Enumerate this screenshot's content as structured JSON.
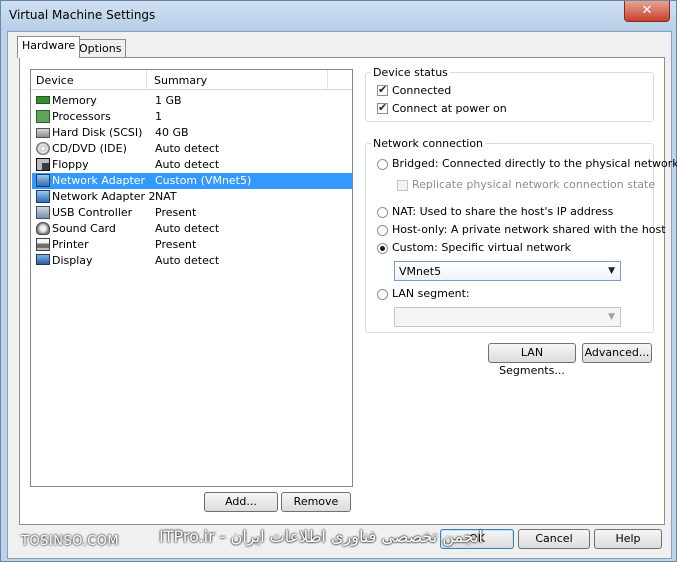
{
  "window": {
    "title": "Virtual Machine Settings",
    "close_glyph": "✕"
  },
  "tabs": [
    {
      "label": "Hardware"
    },
    {
      "label": "Options"
    }
  ],
  "device_list": {
    "headers": {
      "device": "Device",
      "summary": "Summary"
    },
    "rows": [
      {
        "icon": "memory-icon",
        "name": "Memory",
        "summary": "1 GB"
      },
      {
        "icon": "processor-icon",
        "name": "Processors",
        "summary": "1"
      },
      {
        "icon": "hard-disk-icon",
        "name": "Hard Disk (SCSI)",
        "summary": "40 GB"
      },
      {
        "icon": "cd-dvd-icon",
        "name": "CD/DVD (IDE)",
        "summary": "Auto detect"
      },
      {
        "icon": "floppy-icon",
        "name": "Floppy",
        "summary": "Auto detect"
      },
      {
        "icon": "network-adapter-icon",
        "name": "Network Adapter",
        "summary": "Custom (VMnet5)"
      },
      {
        "icon": "network-adapter-icon",
        "name": "Network Adapter 2",
        "summary": "NAT"
      },
      {
        "icon": "usb-icon",
        "name": "USB Controller",
        "summary": "Present"
      },
      {
        "icon": "sound-card-icon",
        "name": "Sound Card",
        "summary": "Auto detect"
      },
      {
        "icon": "printer-icon",
        "name": "Printer",
        "summary": "Present"
      },
      {
        "icon": "display-icon",
        "name": "Display",
        "summary": "Auto detect"
      }
    ],
    "selected": "Network Adapter"
  },
  "list_buttons": {
    "add": "Add...",
    "remove": "Remove"
  },
  "device_status": {
    "title": "Device status",
    "connected": {
      "label": "Connected",
      "checked": true
    },
    "connect_at_power_on": {
      "label": "Connect at power on",
      "checked": true
    }
  },
  "network_connection": {
    "title": "Network connection",
    "bridged": {
      "label": "Bridged: Connected directly to the physical network",
      "selected": false
    },
    "replicate": {
      "label": "Replicate physical network connection state",
      "checked": false,
      "disabled": true
    },
    "nat": {
      "label": "NAT: Used to share the host's IP address",
      "selected": false
    },
    "host_only": {
      "label": "Host-only: A private network shared with the host",
      "selected": false
    },
    "custom": {
      "label": "Custom: Specific virtual network",
      "selected": true
    },
    "custom_select": {
      "value": "VMnet5"
    },
    "lan_segment": {
      "label": "LAN segment:",
      "selected": false
    },
    "lan_select": {
      "value": ""
    }
  },
  "network_buttons": {
    "lan_segments": "LAN Segments...",
    "advanced": "Advanced..."
  },
  "footer_buttons": {
    "ok": "OK",
    "cancel": "Cancel",
    "help": "Help"
  },
  "watermark": {
    "left": "TOSINSO.COM",
    "right": "ITPro.ir - انجمن تخصصی فناوری اطلاعات ایران"
  },
  "colors": {
    "selection": "#3399ff",
    "frame": "#bcd3ea",
    "close": "#c7422b"
  }
}
